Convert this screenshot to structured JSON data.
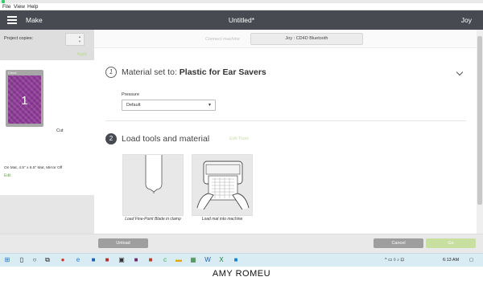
{
  "menubar": {
    "items": [
      "File",
      "View",
      "Help"
    ]
  },
  "header": {
    "section": "Make",
    "doc_title": "Untitled*",
    "user": "Joy"
  },
  "left": {
    "copies_label": "Project copies:",
    "apply_label": "Apply",
    "mat_brand": "Cricut",
    "mat_number": "1",
    "cut_label": "Cut",
    "mat_info": "On Mat, 4.5\" x 6.5\" Mat, Mirror Off",
    "edit_label": "Edit",
    "mat_color": "#8e3a97"
  },
  "connect": {
    "label": "Connect machine",
    "machine": "Joy : CD4D Bluetooth"
  },
  "step1": {
    "number": "1",
    "prefix": "Material set to:",
    "material": "Plastic for Ear Savers"
  },
  "pressure": {
    "label": "Pressure",
    "value": "Default"
  },
  "step2": {
    "number": "2",
    "title": "Load tools and material",
    "edit_tools": "Edit Tools"
  },
  "tiles": {
    "blade_caption": "Load Fine-Point Blade in clamp",
    "mat_caption": "Load mat into machine"
  },
  "buttons": {
    "unload": "Unload",
    "cancel": "Cancel",
    "go": "Go"
  },
  "taskbar": {
    "time": "6:13 AM"
  },
  "credit": "AMY ROMEU",
  "colors": {
    "header": "#474b51",
    "accent_green": "#c7df9f",
    "edit_green": "#6aa84f"
  }
}
